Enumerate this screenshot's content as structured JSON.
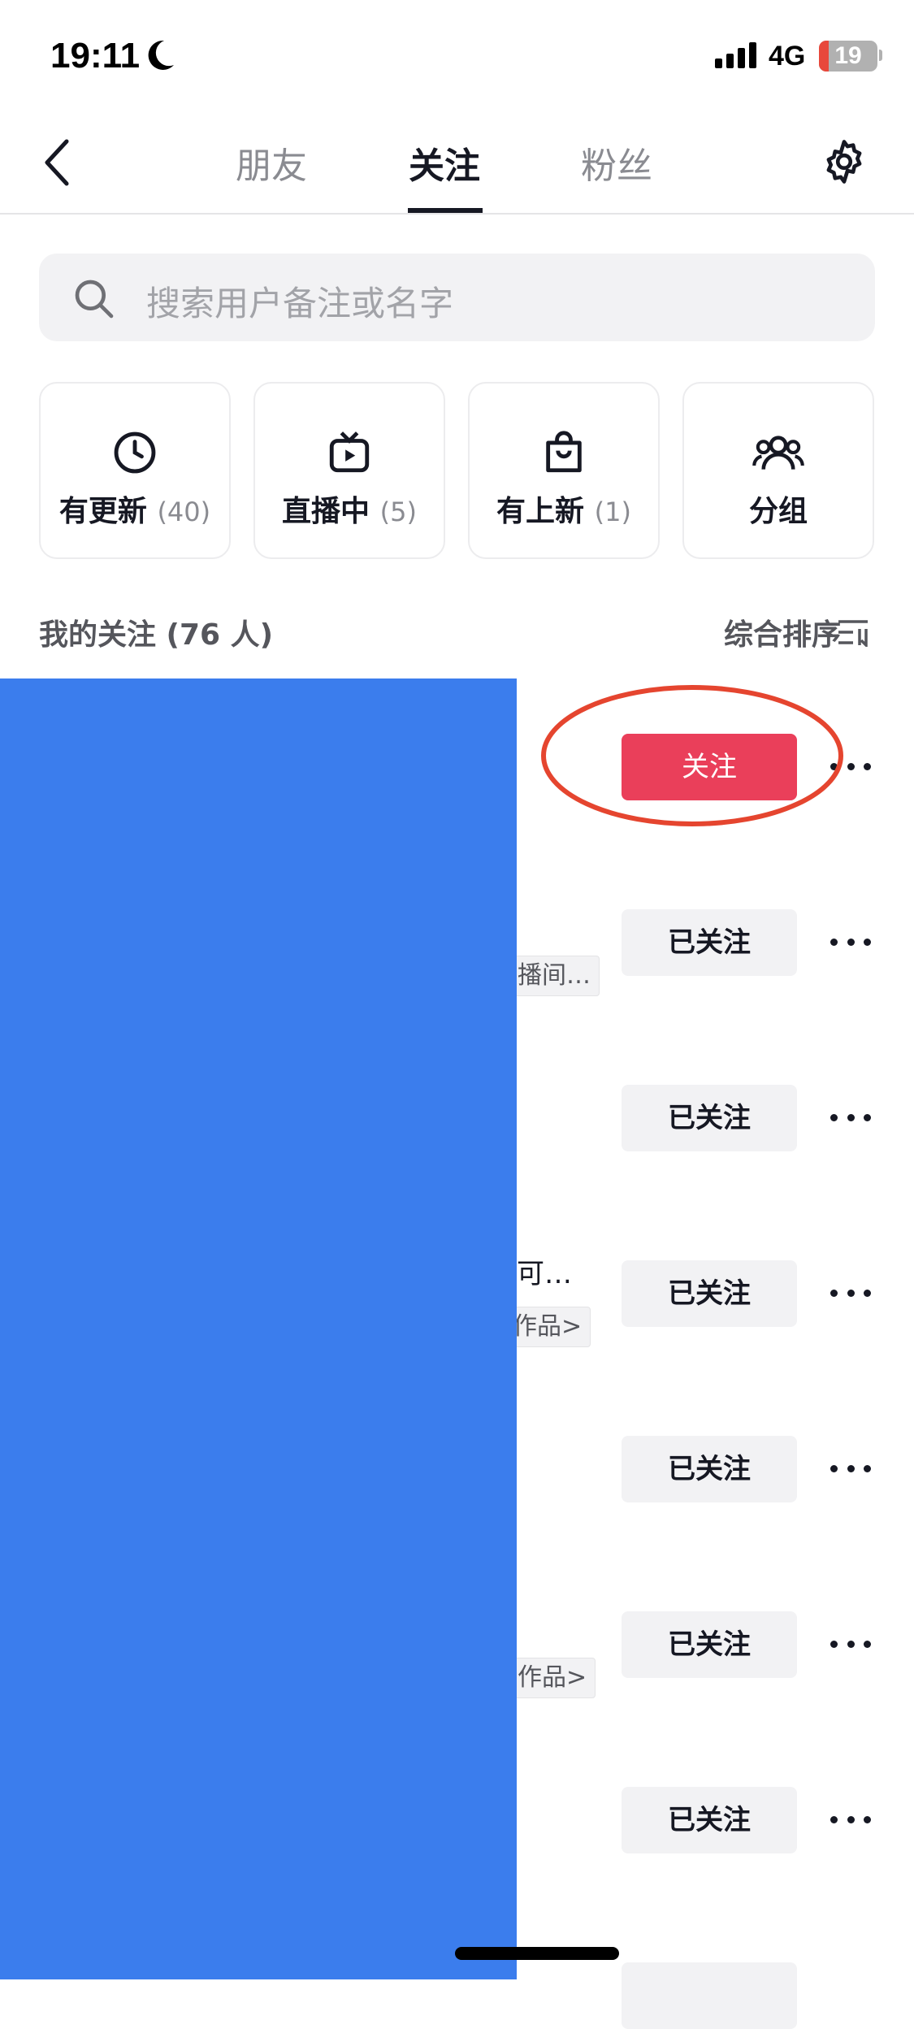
{
  "status_bar": {
    "time": "19:11",
    "network": "4G",
    "battery": "19",
    "colors": {
      "battery_low": "#e8483b"
    }
  },
  "nav": {
    "tabs": [
      {
        "label": "朋友"
      },
      {
        "label": "关注",
        "active": true
      },
      {
        "label": "粉丝"
      }
    ]
  },
  "search": {
    "placeholder": "搜索用户备注或名字"
  },
  "filters": [
    {
      "label": "有更新",
      "count": "(40)",
      "icon": "clock-icon"
    },
    {
      "label": "直播中",
      "count": "(5)",
      "icon": "tv-icon"
    },
    {
      "label": "有上新",
      "count": "(1)",
      "icon": "shopping-bag-icon"
    },
    {
      "label": "分组",
      "count": "",
      "icon": "group-icon"
    }
  ],
  "section": {
    "title": "我的关注 (76 人)",
    "sort_label": "综合排序"
  },
  "rows": [
    {
      "button": "关注",
      "highlighted": true
    },
    {
      "button": "已关注",
      "tag": "播间…"
    },
    {
      "button": "已关注"
    },
    {
      "button": "已关注",
      "name": "可…",
      "tag": "作品>"
    },
    {
      "button": "已关注"
    },
    {
      "button": "已关注",
      "tag": "作品>"
    },
    {
      "button": "已关注"
    }
  ],
  "colors": {
    "follow_red": "#ea3f5a",
    "annotation_circle": "#e5452f",
    "redaction": "#3b7ded"
  }
}
